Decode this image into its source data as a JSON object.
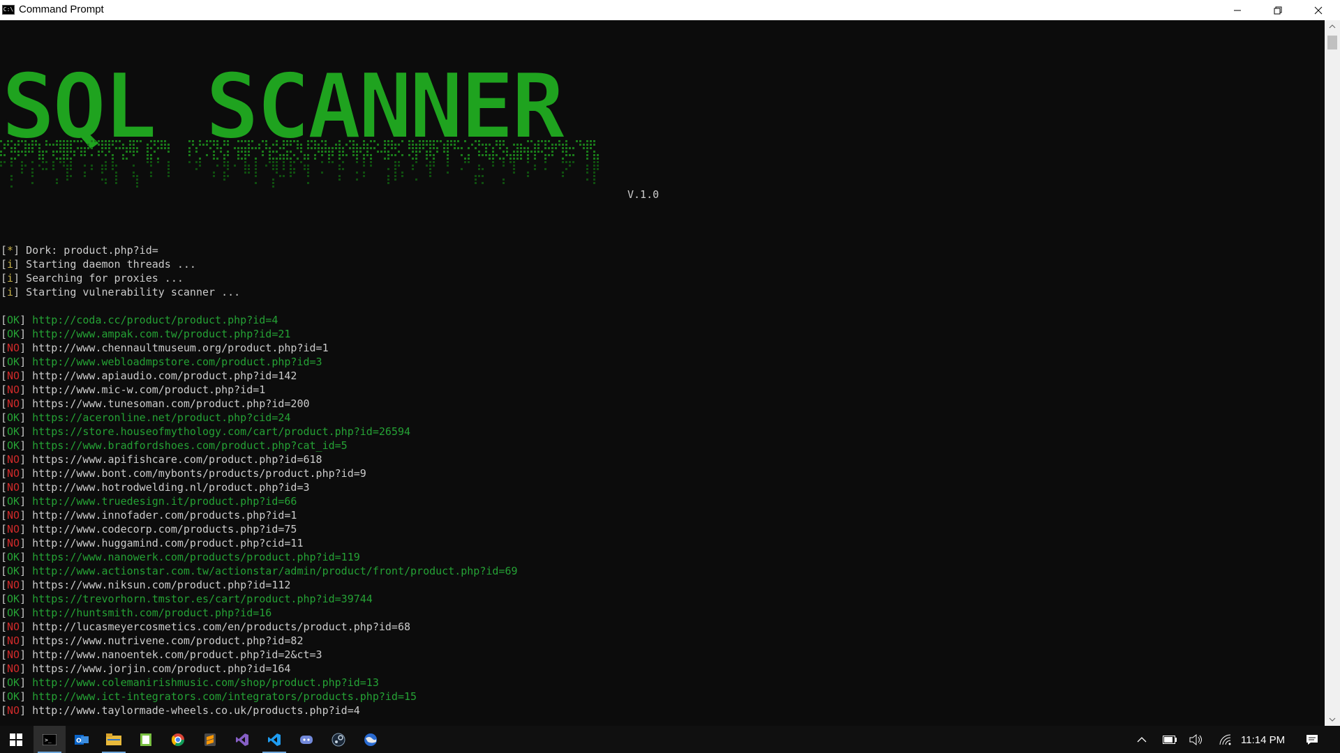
{
  "window": {
    "title": "Command Prompt",
    "icon_name": "cmd-icon"
  },
  "banner": {
    "text": "SQL SCANNER",
    "version": "V.1.0",
    "color": "#1fa31f"
  },
  "info_lines": [
    {
      "tag": "*",
      "text": "Dork: product.php?id="
    },
    {
      "tag": "i",
      "text": "Starting daemon threads ..."
    },
    {
      "tag": "i",
      "text": "Searching for proxies ..."
    },
    {
      "tag": "i",
      "text": "Starting vulnerability scanner ..."
    }
  ],
  "results": [
    {
      "status": "OK",
      "url": "http://coda.cc/product/product.php?id=4"
    },
    {
      "status": "OK",
      "url": "http://www.ampak.com.tw/product.php?id=21"
    },
    {
      "status": "NO",
      "url": "http://www.chennaultmuseum.org/product.php?id=1"
    },
    {
      "status": "OK",
      "url": "http://www.webloadmpstore.com/product.php?id=3"
    },
    {
      "status": "NO",
      "url": "http://www.apiaudio.com/product.php?id=142"
    },
    {
      "status": "NO",
      "url": "http://www.mic-w.com/product.php?id=1"
    },
    {
      "status": "NO",
      "url": "https://www.tunesoman.com/product.php?id=200"
    },
    {
      "status": "OK",
      "url": "https://aceronline.net/product.php?cid=24"
    },
    {
      "status": "OK",
      "url": "https://store.houseofmythology.com/cart/product.php?id=26594"
    },
    {
      "status": "OK",
      "url": "https://www.bradfordshoes.com/product.php?cat_id=5"
    },
    {
      "status": "NO",
      "url": "https://www.apifishcare.com/product.php?id=618"
    },
    {
      "status": "NO",
      "url": "http://www.bont.com/mybonts/products/product.php?id=9"
    },
    {
      "status": "NO",
      "url": "http://www.hotrodwelding.nl/product.php?id=3"
    },
    {
      "status": "OK",
      "url": "http://www.truedesign.it/product.php?id=66"
    },
    {
      "status": "NO",
      "url": "http://www.innofader.com/products.php?id=1"
    },
    {
      "status": "NO",
      "url": "http://www.codecorp.com/products.php?id=75"
    },
    {
      "status": "NO",
      "url": "http://www.huggamind.com/product.php?cid=11"
    },
    {
      "status": "OK",
      "url": "https://www.nanowerk.com/products/product.php?id=119"
    },
    {
      "status": "OK",
      "url": "http://www.actionstar.com.tw/actionstar/admin/product/front/product.php?id=69"
    },
    {
      "status": "NO",
      "url": "https://www.niksun.com/product.php?id=112"
    },
    {
      "status": "OK",
      "url": "https://trevorhorn.tmstor.es/cart/product.php?id=39744"
    },
    {
      "status": "OK",
      "url": "http://huntsmith.com/product.php?id=16"
    },
    {
      "status": "NO",
      "url": "http://lucasmeyercosmetics.com/en/products/product.php?id=68"
    },
    {
      "status": "NO",
      "url": "https://www.nutrivene.com/product.php?id=82"
    },
    {
      "status": "NO",
      "url": "http://www.nanoentek.com/product.php?id=2&ct=3"
    },
    {
      "status": "NO",
      "url": "https://www.jorjin.com/product.php?id=164"
    },
    {
      "status": "OK",
      "url": "http://www.colemanirishmusic.com/shop/product.php?id=13"
    },
    {
      "status": "OK",
      "url": "http://www.ict-integrators.com/integrators/products.php?id=15"
    },
    {
      "status": "NO",
      "url": "http://www.taylormade-wheels.co.uk/products.php?id=4"
    }
  ],
  "taskbar": {
    "apps": [
      "start-icon",
      "cmd-icon",
      "outlook-icon",
      "file-explorer-icon",
      "notepad-plus-icon",
      "chrome-icon",
      "sublime-text-icon",
      "visual-studio-icon",
      "vscode-icon",
      "discord-icon",
      "steam-icon",
      "browser-globe-icon"
    ],
    "clock": "11:14 PM"
  },
  "colors": {
    "ok": "#25a235",
    "no": "#d02a2a",
    "info": "#c8b24a",
    "text": "#cccccc",
    "background": "#0c0c0c"
  }
}
